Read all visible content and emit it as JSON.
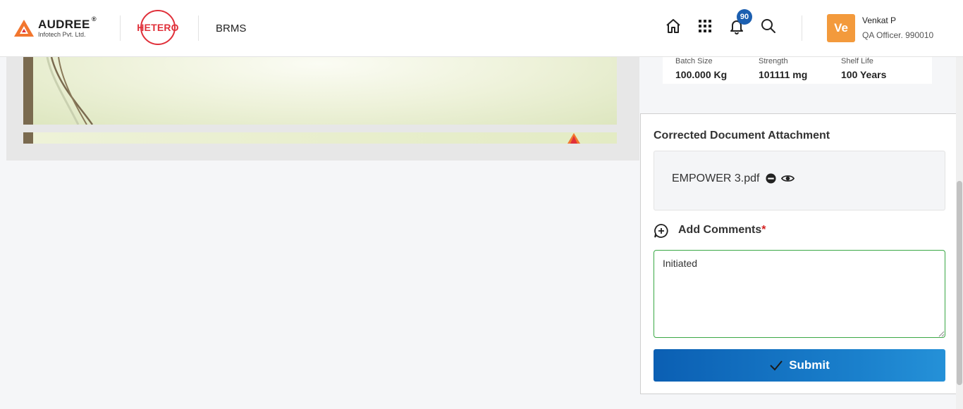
{
  "header": {
    "brand_name": "AUDREE",
    "brand_reg": "®",
    "brand_sub": "Infotech Pvt. Ltd.",
    "partner_logo": "HETERO",
    "app_name": "BRMS",
    "icons": [
      "home-icon",
      "apps-grid-icon",
      "bell-icon",
      "search-icon"
    ],
    "notification_count": "90",
    "user": {
      "initials": "Ve",
      "name": "Venkat P",
      "role": "QA Officer. 990010"
    },
    "colors": {
      "badge": "#1c5fb0",
      "avatar": "#f39a3c",
      "brand_orange": "#f2762e",
      "hetero_red": "#e0303a"
    }
  },
  "batch_info": [
    {
      "label": "Batch Size",
      "value": "100.000 Kg"
    },
    {
      "label": "Strength",
      "value": "101111 mg"
    },
    {
      "label": "Shelf Life",
      "value": "100 Years"
    }
  ],
  "attachment": {
    "title": "Corrected Document Attachment",
    "file_name": "EMPOWER 3.pdf",
    "icons": [
      "remove-icon",
      "eye-icon"
    ]
  },
  "comments": {
    "label": "Add Comments",
    "required_mark": "*",
    "value": "Initiated",
    "border_color": "#3aa845"
  },
  "submit": {
    "label": "Submit",
    "color": "#0b5fb3"
  }
}
